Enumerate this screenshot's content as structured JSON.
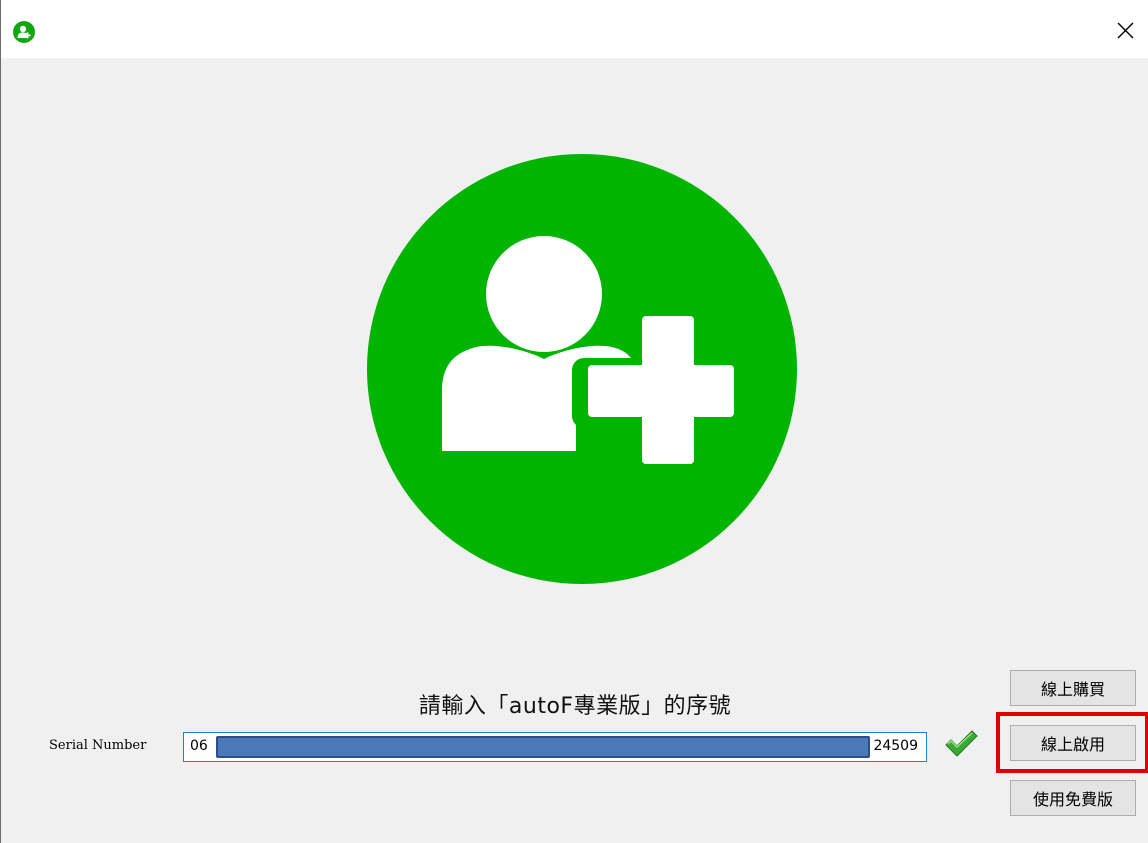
{
  "window": {
    "app_icon": "user-plus-icon",
    "close_icon": "close-icon"
  },
  "hero": {
    "icon": "add-user-icon",
    "color": "#00b400"
  },
  "prompt": "請輸入「autoF專業版」的序號",
  "serial": {
    "label": "Serial Number",
    "prefix": "06",
    "suffix": "24509",
    "valid_icon": "check-icon"
  },
  "buttons": {
    "buy_online": "線上購買",
    "activate_online": "線上啟用",
    "use_free": "使用免費版"
  },
  "colors": {
    "accent_green": "#00b400",
    "highlight_red": "#e00000",
    "input_border": "#1f7fd6"
  }
}
